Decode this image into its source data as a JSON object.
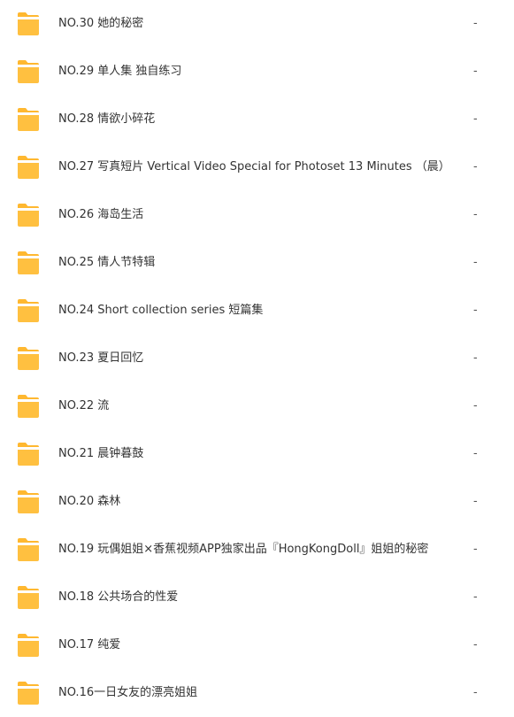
{
  "colors": {
    "folder_body": "#ffc040",
    "folder_tab": "#ffb830",
    "folder_highlight": "#ffffff"
  },
  "files": [
    {
      "name": "NO.30 她的秘密",
      "size": "-",
      "icon": "folder-icon"
    },
    {
      "name": "NO.29 单人集 独自练习",
      "size": "-",
      "icon": "folder-icon"
    },
    {
      "name": "NO.28 情欲小碎花",
      "size": "-",
      "icon": "folder-icon"
    },
    {
      "name": "NO.27 写真短片 Vertical Video Special for Photoset 13 Minutes （晨）",
      "size": "-",
      "icon": "folder-icon"
    },
    {
      "name": "NO.26 海岛生活",
      "size": "-",
      "icon": "folder-icon"
    },
    {
      "name": "NO.25 情人节特辑",
      "size": "-",
      "icon": "folder-icon"
    },
    {
      "name": "NO.24 Short collection series 短篇集",
      "size": "-",
      "icon": "folder-icon"
    },
    {
      "name": "NO.23 夏日回忆",
      "size": "-",
      "icon": "folder-icon"
    },
    {
      "name": "NO.22 流",
      "size": "-",
      "icon": "folder-icon"
    },
    {
      "name": "NO.21 晨钟暮鼓",
      "size": "-",
      "icon": "folder-icon"
    },
    {
      "name": "NO.20 森林",
      "size": "-",
      "icon": "folder-icon"
    },
    {
      "name": "NO.19 玩偶姐姐×香蕉视频APP独家出品『HongKongDoll』姐姐的秘密",
      "size": "-",
      "icon": "folder-icon"
    },
    {
      "name": "NO.18 公共场合的性爱",
      "size": "-",
      "icon": "folder-icon"
    },
    {
      "name": "NO.17 纯爱",
      "size": "-",
      "icon": "folder-icon"
    },
    {
      "name": "NO.16一日女友的漂亮姐姐",
      "size": "-",
      "icon": "folder-icon"
    }
  ]
}
